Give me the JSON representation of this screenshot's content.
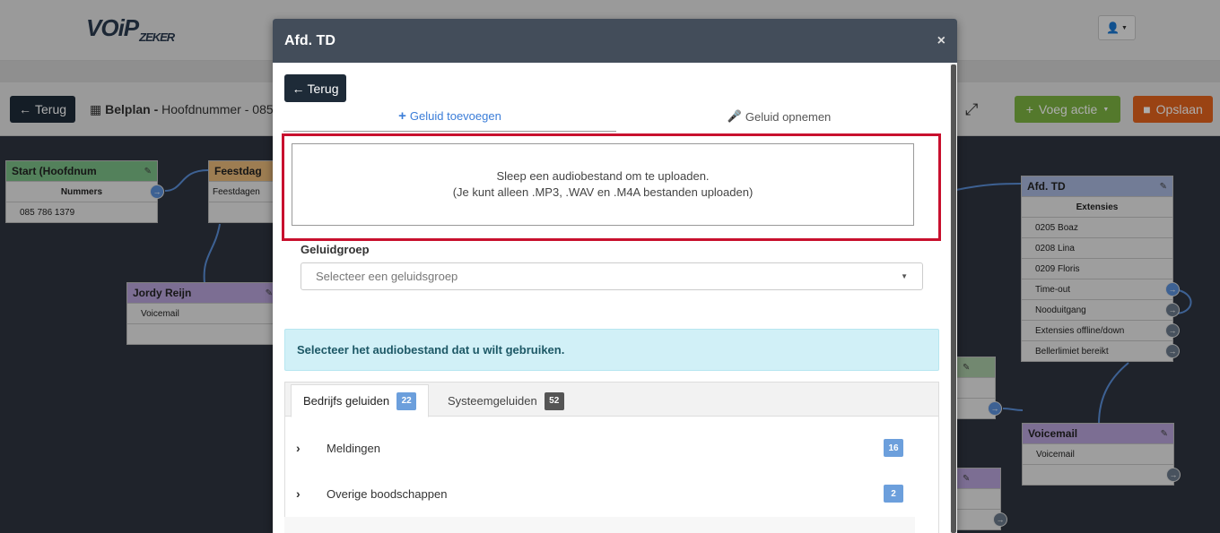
{
  "app": {
    "logo_main": "VOiP",
    "logo_sub": "ZEKER"
  },
  "toolbar": {
    "back_label": "Terug",
    "breadcrumb_bold": "Belplan -",
    "breadcrumb_text": "Hoofdnummer - 085",
    "add_action_label": "Voeg actie",
    "save_label": "Opslaan"
  },
  "nodes": {
    "start": {
      "title": "Start (Hoofdnum",
      "header": "Nummers",
      "row": "085 786 1379"
    },
    "feestdagen": {
      "title": "Feestdag",
      "row": "Feestdagen"
    },
    "jordy": {
      "title": "Jordy Reijn",
      "row": "Voicemail"
    },
    "afd_td": {
      "title": "Afd. TD",
      "header": "Extensies",
      "rows": [
        "0205 Boaz",
        "0208 Lina",
        "0209 Floris",
        "Time-out",
        "Nooduitgang",
        "Extensies offline/down",
        "Bellerlimiet bereikt"
      ]
    },
    "voicemail": {
      "title": "Voicemail",
      "row": "Voicemail"
    }
  },
  "modal": {
    "title": "Afd. TD",
    "close": "×",
    "back_label": "Terug",
    "tab_add": "Geluid toevoegen",
    "tab_record": "Geluid opnemen",
    "dropzone_line1": "Sleep een audiobestand om te uploaden.",
    "dropzone_line2": "(Je kunt alleen .MP3, .WAV en .M4A bestanden uploaden)",
    "group_label": "Geluidgroep",
    "group_placeholder": "Selecteer een geluidsgroep",
    "alert": "Selecteer het audiobestand dat u wilt gebruiken.",
    "subtabs": [
      {
        "label": "Bedrijfs geluiden",
        "count": "22"
      },
      {
        "label": "Systeemgeluiden",
        "count": "52"
      }
    ],
    "categories": [
      {
        "label": "Meldingen",
        "count": "16"
      },
      {
        "label": "Overige boodschappen",
        "count": "2"
      }
    ]
  },
  "colors": {
    "accent": "#3b7dd8",
    "dark": "#1e2b38",
    "green": "#7cb342",
    "orange": "#e4631d",
    "highlight": "#c8102e"
  }
}
